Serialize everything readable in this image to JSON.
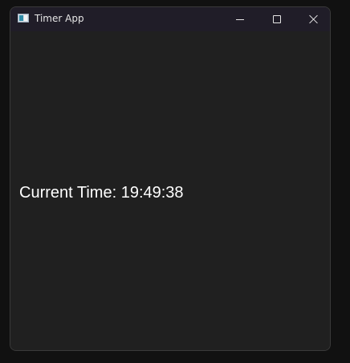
{
  "window": {
    "title": "Timer App",
    "app_icon": "window-app-icon",
    "controls": {
      "minimize_icon": "minimize-icon",
      "maximize_icon": "maximize-icon",
      "close_icon": "close-icon"
    }
  },
  "content": {
    "time_text": "Current Time: 19:49:38"
  },
  "colors": {
    "background": "#202020",
    "titlebar": "#201d28",
    "text": "#ffffff"
  }
}
